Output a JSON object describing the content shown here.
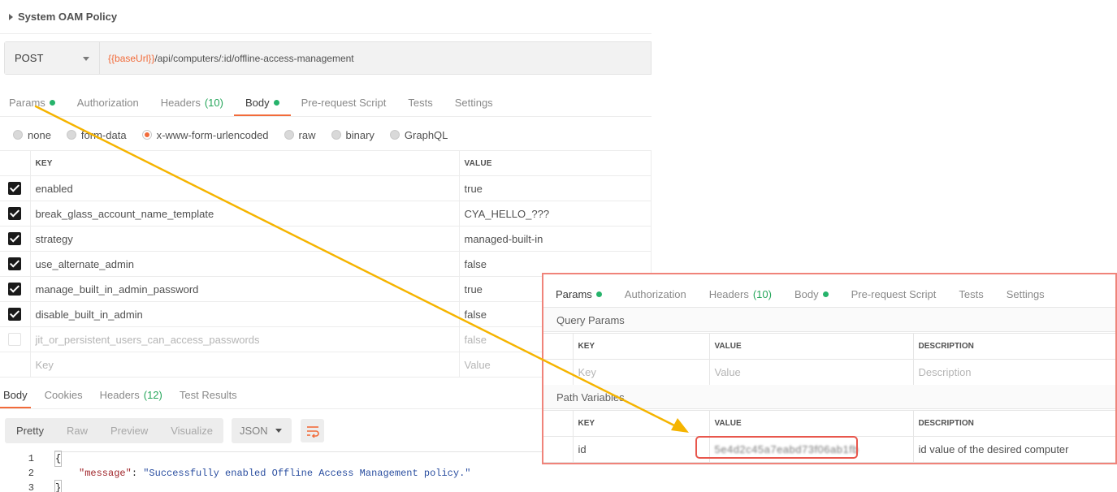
{
  "collection": {
    "title": "System OAM Policy"
  },
  "request": {
    "method": "POST",
    "url_variable": "{{baseUrl}}",
    "url_path": "/api/computers/:id/offline-access-management"
  },
  "request_tabs": [
    {
      "label": "Params",
      "dot": true,
      "count": ""
    },
    {
      "label": "Authorization",
      "dot": false,
      "count": ""
    },
    {
      "label": "Headers",
      "dot": false,
      "count": "(10)"
    },
    {
      "label": "Body",
      "dot": true,
      "count": ""
    },
    {
      "label": "Pre-request Script",
      "dot": false,
      "count": ""
    },
    {
      "label": "Tests",
      "dot": false,
      "count": ""
    },
    {
      "label": "Settings",
      "dot": false,
      "count": ""
    }
  ],
  "body_modes": [
    "none",
    "form-data",
    "x-www-form-urlencoded",
    "raw",
    "binary",
    "GraphQL"
  ],
  "body_mode_selected": "x-www-form-urlencoded",
  "body_table": {
    "key_header": "KEY",
    "value_header": "VALUE",
    "rows": [
      {
        "key": "enabled",
        "value": "true",
        "checked": true
      },
      {
        "key": "break_glass_account_name_template",
        "value": "CYA_HELLO_???",
        "checked": true
      },
      {
        "key": "strategy",
        "value": "managed-built-in",
        "checked": true
      },
      {
        "key": "use_alternate_admin",
        "value": "false",
        "checked": true
      },
      {
        "key": "manage_built_in_admin_password",
        "value": "true",
        "checked": true
      },
      {
        "key": "disable_built_in_admin",
        "value": "false",
        "checked": true
      },
      {
        "key": "jit_or_persistent_users_can_access_passwords",
        "value": "false",
        "checked": false
      }
    ],
    "placeholder_key": "Key",
    "placeholder_value": "Value"
  },
  "response_tabs": [
    {
      "label": "Body",
      "count": ""
    },
    {
      "label": "Cookies",
      "count": ""
    },
    {
      "label": "Headers",
      "count": "(12)"
    },
    {
      "label": "Test Results",
      "count": ""
    }
  ],
  "response_toolbar": {
    "views": [
      "Pretty",
      "Raw",
      "Preview",
      "Visualize"
    ],
    "selected_view": "Pretty",
    "format": "JSON"
  },
  "response_body": {
    "line_numbers": [
      "1",
      "2",
      "3"
    ],
    "open_brace": "{",
    "close_brace": "}",
    "key": "\"message\"",
    "colon": ": ",
    "value": "\"Successfully enabled Offline Access Management policy.\""
  },
  "inset": {
    "tabs": [
      {
        "label": "Params",
        "dot": true,
        "count": ""
      },
      {
        "label": "Authorization",
        "dot": false,
        "count": ""
      },
      {
        "label": "Headers",
        "dot": false,
        "count": "(10)"
      },
      {
        "label": "Body",
        "dot": true,
        "count": ""
      },
      {
        "label": "Pre-request Script",
        "dot": false,
        "count": ""
      },
      {
        "label": "Tests",
        "dot": false,
        "count": ""
      },
      {
        "label": "Settings",
        "dot": false,
        "count": ""
      }
    ],
    "query_params_label": "Query Params",
    "path_variables_label": "Path Variables",
    "headers": {
      "key": "KEY",
      "value": "VALUE",
      "description": "DESCRIPTION"
    },
    "query_placeholders": {
      "key": "Key",
      "value": "Value",
      "description": "Description"
    },
    "path_row": {
      "key": "id",
      "value": "5e4d2c45a7eabd73f06ab1fb",
      "description": "id value of the desired computer"
    }
  },
  "colors": {
    "accent": "#f26b3a",
    "active_dot": "#26b36b",
    "annotation_arrow": "#f5b400",
    "highlight_box": "#e8574d"
  }
}
